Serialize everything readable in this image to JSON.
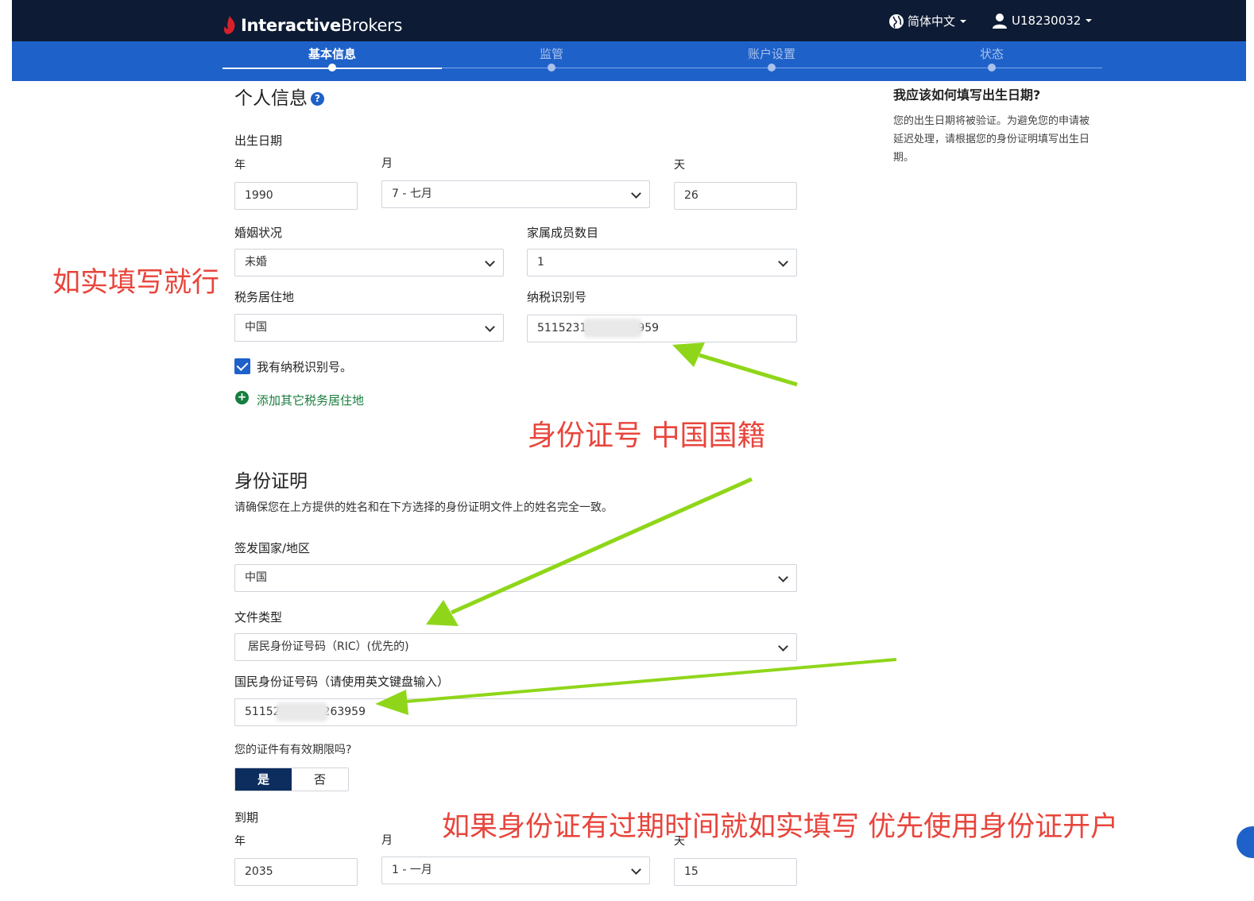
{
  "brand": {
    "name_bold": "Interactive",
    "name_rest": "Brokers"
  },
  "header": {
    "language": "简体中文",
    "account": "U18230032"
  },
  "steps": [
    {
      "label": "基本信息",
      "active": true
    },
    {
      "label": "监管",
      "active": false
    },
    {
      "label": "账户设置",
      "active": false
    },
    {
      "label": "状态",
      "active": false
    }
  ],
  "personal": {
    "title": "个人信息",
    "help_glyph": "?",
    "dob_label": "出生日期",
    "year_label": "年",
    "month_label": "月",
    "day_label": "天",
    "year_value": "1990",
    "month_value": "7 - 七月",
    "day_value": "26",
    "marital_label": "婚姻状况",
    "marital_value": "未婚",
    "household_label": "家属成员数目",
    "household_value": "1",
    "tax_country_label": "税务居住地",
    "tax_country_value": "中国",
    "tin_label": "纳税识别号",
    "tin_prefix": "5115231",
    "tin_suffix": "959",
    "has_tin_label": "我有纳税识别号。",
    "add_tax_link": "添加其它税务居住地"
  },
  "identity": {
    "title": "身份证明",
    "note": "请确保您在上方提供的姓名和在下方选择的身份证明文件上的姓名完全一致。",
    "issue_country_label": "签发国家/地区",
    "issue_country_value": "中国",
    "doc_type_label": "文件类型",
    "doc_type_value": "居民身份证号码（RIC）(优先的)",
    "id_number_label": "国民身份证号码（请使用英文键盘输入）",
    "id_prefix": "51152",
    "id_suffix": "263959",
    "expiry_question": "您的证件有有效期限吗?",
    "yes_label": "是",
    "no_label": "否",
    "expiry_label": "到期",
    "exp_year_label": "年",
    "exp_month_label": "月",
    "exp_day_label": "天",
    "exp_year_value": "2035",
    "exp_month_value": "1 - 一月",
    "exp_day_value": "15"
  },
  "sidebar": {
    "title": "我应该如何填写出生日期?",
    "body": "您的出生日期将被验证。为避免您的申请被延迟处理，请根据您的身份证明填写出生日期。"
  },
  "annotations": {
    "left_note": "如实填写就行",
    "id_note": "身份证号 中国国籍",
    "expiry_note": "如果身份证有过期时间就如实填写 优先使用身份证开户"
  },
  "colors": {
    "header": "#0d1b34",
    "stepbar": "#1e61c9",
    "annotation": "#e8453c",
    "arrow": "#8fd61a",
    "link_green": "#177e3e"
  }
}
